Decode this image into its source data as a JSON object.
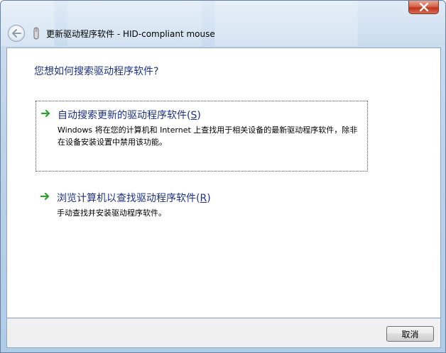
{
  "window": {
    "title": "更新驱动程序软件 - HID-compliant mouse"
  },
  "content": {
    "heading": "您想如何搜索驱动程序软件?",
    "options": [
      {
        "title": "自动搜索更新的驱动程序软件",
        "accel_open": "(",
        "accel_key": "S",
        "accel_close": ")",
        "description": "Windows 将在您的计算机和 Internet 上查找用于相关设备的最新驱动程序软件，除非在设备安装设置中禁用该功能。",
        "focused": true
      },
      {
        "title": "浏览计算机以查找驱动程序软件",
        "accel_open": "(",
        "accel_key": "R",
        "accel_close": ")",
        "description": "手动查找并安装驱动程序软件。",
        "focused": false
      }
    ]
  },
  "footer": {
    "cancel_label": "取消"
  },
  "colors": {
    "link_blue": "#1e3287",
    "arrow_green": "#2f9e2f",
    "close_red": "#c2351e"
  },
  "icons": {
    "back": "back-arrow-icon",
    "close": "close-icon",
    "device": "mouse-device-icon",
    "option_arrow": "green-arrow-icon"
  }
}
